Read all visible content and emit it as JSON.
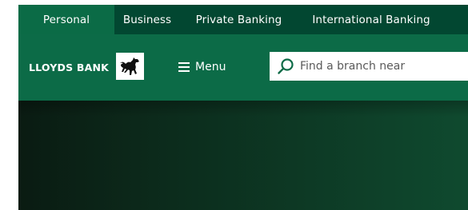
{
  "top_nav": {
    "tabs": [
      {
        "label": "Personal",
        "active": true
      },
      {
        "label": "Business"
      },
      {
        "label": "Private Banking"
      },
      {
        "label": "International Banking"
      }
    ]
  },
  "header": {
    "brand": "LLOYDS BANK",
    "logo_icon": "black-horse-icon",
    "menu_label": "Menu",
    "menu_icon": "hamburger-icon"
  },
  "search": {
    "placeholder": "Find a branch near",
    "icon": "search-icon"
  },
  "colors": {
    "nav_bg": "#024731",
    "active_tab": "#0b6b46",
    "header_bg": "#0c6b47",
    "search_icon": "#0c6b47"
  }
}
